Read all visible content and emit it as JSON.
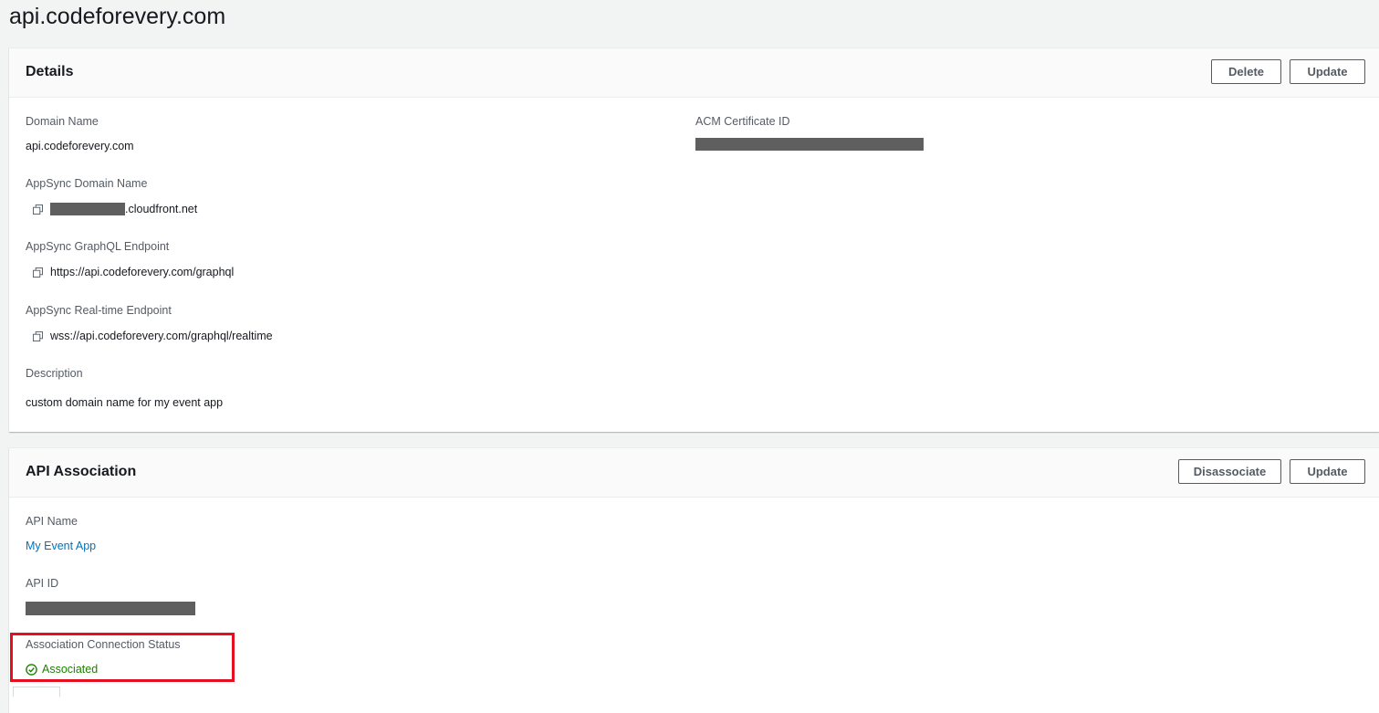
{
  "page": {
    "title": "api.codeforevery.com"
  },
  "details": {
    "title": "Details",
    "delete_label": "Delete",
    "update_label": "Update",
    "domain_name_label": "Domain Name",
    "domain_name_value": "api.codeforevery.com",
    "acm_label": "ACM Certificate ID",
    "appsync_domain_label": "AppSync Domain Name",
    "appsync_domain_suffix": ".cloudfront.net",
    "graphql_endpoint_label": "AppSync GraphQL Endpoint",
    "graphql_endpoint_value": "https://api.codeforevery.com/graphql",
    "realtime_endpoint_label": "AppSync Real-time Endpoint",
    "realtime_endpoint_value": "wss://api.codeforevery.com/graphql/realtime",
    "description_label": "Description",
    "description_value": "custom domain name for my event app"
  },
  "api_association": {
    "title": "API Association",
    "disassociate_label": "Disassociate",
    "update_label": "Update",
    "api_name_label": "API Name",
    "api_name_value": "My Event App",
    "api_id_label": "API ID",
    "status_label": "Association Connection Status",
    "status_value": "Associated"
  },
  "colors": {
    "link": "#0073bb",
    "success": "#1d8102",
    "highlight": "#e60f1f",
    "redacted": "#5f5f5f"
  },
  "icons": [
    "copy-icon",
    "check-circle-icon"
  ]
}
